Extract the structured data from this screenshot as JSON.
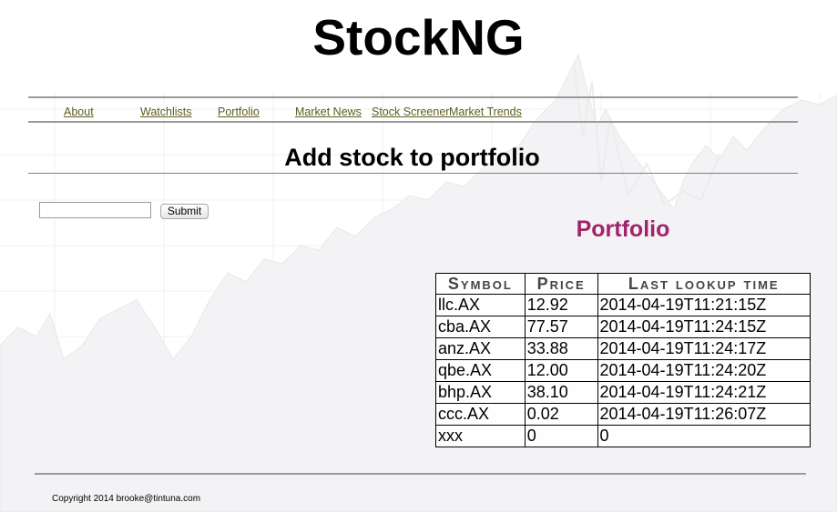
{
  "site": {
    "title": "StockNG"
  },
  "nav": {
    "items": [
      {
        "label": "About"
      },
      {
        "label": "Watchlists"
      },
      {
        "label": "Portfolio"
      },
      {
        "label": "Market News"
      },
      {
        "label": "Stock Screener"
      },
      {
        "label": "Market Trends"
      }
    ],
    "link_color": "#5d5d1f"
  },
  "page": {
    "heading": "Add stock to portfolio"
  },
  "form": {
    "symbol_value": "",
    "submit_label": "Submit"
  },
  "portfolio": {
    "title": "Portfolio",
    "title_color": "#a0236c",
    "columns": [
      "Symbol",
      "Price",
      "Last lookup time"
    ],
    "rows": [
      {
        "symbol": "llc.AX",
        "price": "12.92",
        "time": "2014-04-19T11:21:15Z"
      },
      {
        "symbol": "cba.AX",
        "price": "77.57",
        "time": "2014-04-19T11:24:15Z"
      },
      {
        "symbol": "anz.AX",
        "price": "33.88",
        "time": "2014-04-19T11:24:17Z"
      },
      {
        "symbol": "qbe.AX",
        "price": "12.00",
        "time": "2014-04-19T11:24:20Z"
      },
      {
        "symbol": "bhp.AX",
        "price": "38.10",
        "time": "2014-04-19T11:24:21Z"
      },
      {
        "symbol": "ccc.AX",
        "price": "0.02",
        "time": "2014-04-19T11:26:07Z"
      },
      {
        "symbol": "xxx",
        "price": "0",
        "time": "0"
      }
    ]
  },
  "footer": {
    "copyright": "Copyright 2014 brooke@tintuna.com"
  }
}
